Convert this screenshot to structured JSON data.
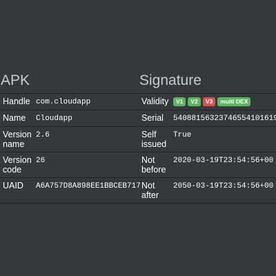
{
  "apk": {
    "title": "APK",
    "rows": [
      {
        "label": "Handle",
        "value": "com.cloudapp"
      },
      {
        "label": "Name",
        "value": "Cloudapp"
      },
      {
        "label": "Version name",
        "value": "2.6"
      },
      {
        "label": "Version code",
        "value": "26"
      },
      {
        "label": "UAID",
        "value": "A6A757D8A898EE1BBCEB717"
      }
    ]
  },
  "signature": {
    "title": "Signature",
    "validity_label": "Validity",
    "badges": [
      {
        "text": "V1",
        "color": "#5cb85c"
      },
      {
        "text": "V2",
        "color": "#5cb85c"
      },
      {
        "text": "V3",
        "color": "#d9534f"
      },
      {
        "text": "multi DEX",
        "color": "#5cb85c"
      }
    ],
    "rows": [
      {
        "label": "Serial",
        "value": "5408815632374655410161900"
      },
      {
        "label": "Self issued",
        "value": "True"
      },
      {
        "label": "Not before",
        "value": "2020-03-19T23:54:56+00"
      },
      {
        "label": "Not after",
        "value": "2050-03-19T23:54:56+00"
      }
    ]
  },
  "colors": {
    "background": "#36393b",
    "title_text": "#c8cbcd",
    "divider": "#222426"
  }
}
